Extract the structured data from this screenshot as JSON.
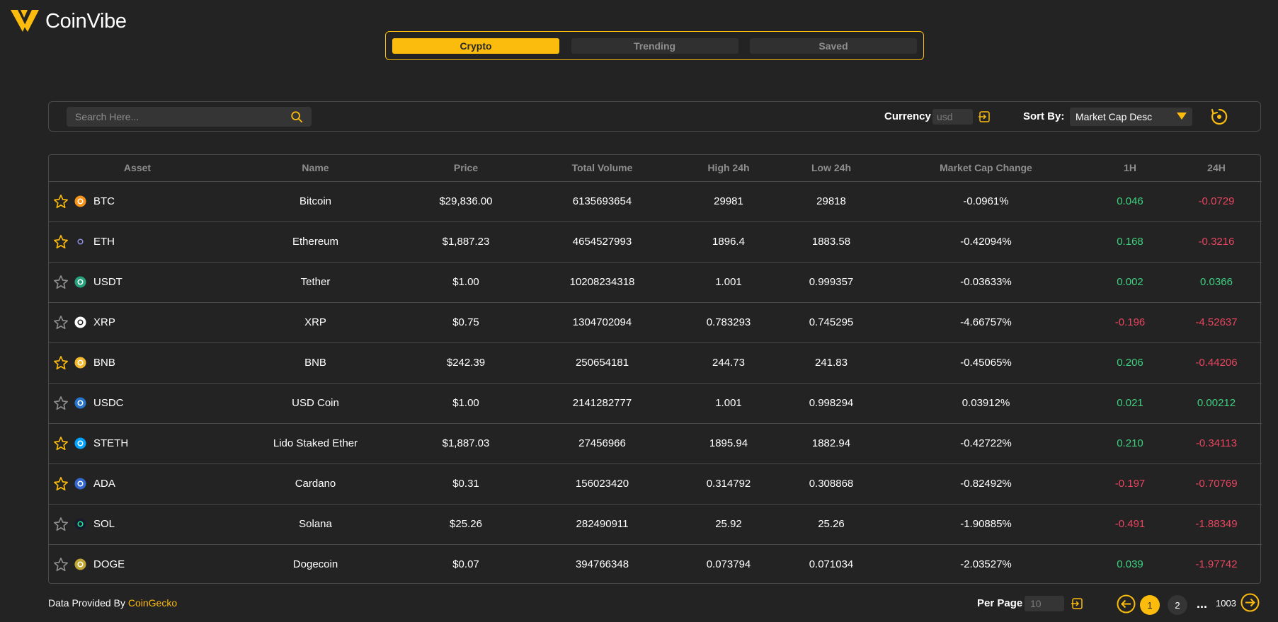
{
  "app": {
    "name": "CoinVibe",
    "accent": "#fbbc0e"
  },
  "tabs": [
    {
      "label": "Crypto",
      "active": true
    },
    {
      "label": "Trending",
      "active": false
    },
    {
      "label": "Saved",
      "active": false
    }
  ],
  "toolbar": {
    "search_placeholder": "Search Here...",
    "currency_label": "Currency",
    "currency_value": "usd",
    "sort_label": "Sort By:",
    "sort_value": "Market Cap Desc"
  },
  "table": {
    "headers": [
      "Asset",
      "Name",
      "Price",
      "Total Volume",
      "High 24h",
      "Low 24h",
      "Market Cap Change",
      "1H",
      "24H"
    ],
    "rows": [
      {
        "starred": true,
        "icon": "btc-icon",
        "icon_color": "#f7931a",
        "symbol": "BTC",
        "name": "Bitcoin",
        "price": "$29,836.00",
        "volume": "6135693654",
        "high": "29981",
        "low": "29818",
        "mcap_change": "-0.0961%",
        "h1": "0.046",
        "h24": "-0.0729"
      },
      {
        "starred": true,
        "icon": "eth-icon",
        "icon_color": "#8c8fe0",
        "symbol": "ETH",
        "name": "Ethereum",
        "price": "$1,887.23",
        "volume": "4654527993",
        "high": "1896.4",
        "low": "1883.58",
        "mcap_change": "-0.42094%",
        "h1": "0.168",
        "h24": "-0.3216"
      },
      {
        "starred": false,
        "icon": "usdt-icon",
        "icon_color": "#26a17b",
        "symbol": "USDT",
        "name": "Tether",
        "price": "$1.00",
        "volume": "10208234318",
        "high": "1.001",
        "low": "0.999357",
        "mcap_change": "-0.03633%",
        "h1": "0.002",
        "h24": "0.0366"
      },
      {
        "starred": false,
        "icon": "xrp-icon",
        "icon_color": "#ffffff",
        "symbol": "XRP",
        "name": "XRP",
        "price": "$0.75",
        "volume": "1304702094",
        "high": "0.783293",
        "low": "0.745295",
        "mcap_change": "-4.66757%",
        "h1": "-0.196",
        "h24": "-4.52637"
      },
      {
        "starred": true,
        "icon": "bnb-icon",
        "icon_color": "#f3ba2f",
        "symbol": "BNB",
        "name": "BNB",
        "price": "$242.39",
        "volume": "250654181",
        "high": "244.73",
        "low": "241.83",
        "mcap_change": "-0.45065%",
        "h1": "0.206",
        "h24": "-0.44206"
      },
      {
        "starred": false,
        "icon": "usdc-icon",
        "icon_color": "#2775ca",
        "symbol": "USDC",
        "name": "USD Coin",
        "price": "$1.00",
        "volume": "2141282777",
        "high": "1.001",
        "low": "0.998294",
        "mcap_change": "0.03912%",
        "h1": "0.021",
        "h24": "0.00212"
      },
      {
        "starred": true,
        "icon": "steth-icon",
        "icon_color": "#00a3ff",
        "symbol": "STETH",
        "name": "Lido Staked Ether",
        "price": "$1,887.03",
        "volume": "27456966",
        "high": "1895.94",
        "low": "1882.94",
        "mcap_change": "-0.42722%",
        "h1": "0.210",
        "h24": "-0.34113"
      },
      {
        "starred": true,
        "icon": "ada-icon",
        "icon_color": "#3468d1",
        "symbol": "ADA",
        "name": "Cardano",
        "price": "$0.31",
        "volume": "156023420",
        "high": "0.314792",
        "low": "0.308868",
        "mcap_change": "-0.82492%",
        "h1": "-0.197",
        "h24": "-0.70769"
      },
      {
        "starred": false,
        "icon": "sol-icon",
        "icon_color": "#14f195",
        "symbol": "SOL",
        "name": "Solana",
        "price": "$25.26",
        "volume": "282490911",
        "high": "25.92",
        "low": "25.26",
        "mcap_change": "-1.90885%",
        "h1": "-0.491",
        "h24": "-1.88349"
      },
      {
        "starred": false,
        "icon": "doge-icon",
        "icon_color": "#c2a633",
        "symbol": "DOGE",
        "name": "Dogecoin",
        "price": "$0.07",
        "volume": "394766348",
        "high": "0.073794",
        "low": "0.071034",
        "mcap_change": "-2.03527%",
        "h1": "0.039",
        "h24": "-1.97742"
      }
    ]
  },
  "footer": {
    "provided_by": "Data Provided By ",
    "provider": "CoinGecko",
    "per_page_label": "Per Page",
    "per_page_value": "10",
    "pages": [
      "1",
      "2"
    ],
    "dots": "...",
    "last_page": "1003"
  },
  "colors": {
    "positive": "#3ed07f",
    "negative": "#e8455f",
    "background": "#232323"
  }
}
